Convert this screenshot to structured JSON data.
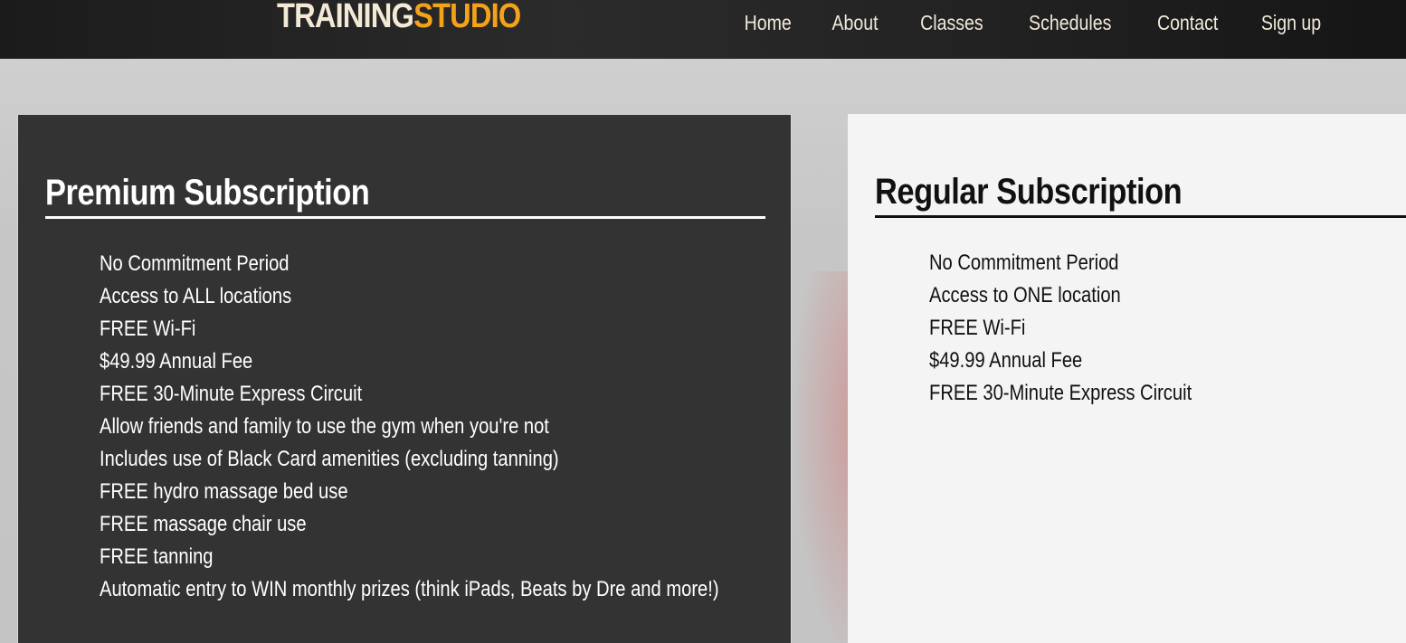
{
  "logo": {
    "part1": "TRAINING",
    "part2": "STUDIO"
  },
  "nav": [
    "Home",
    "About",
    "Classes",
    "Schedules",
    "Contact",
    "Sign up"
  ],
  "premium": {
    "title": "Premium Subscription",
    "features": [
      "No Commitment Period",
      "Access to ALL locations",
      "FREE Wi-Fi",
      "$49.99 Annual Fee",
      "FREE 30-Minute Express Circuit",
      "Allow friends and family to use the gym when you're not",
      "Includes use of Black Card amenities (excluding tanning)",
      "FREE hydro massage bed use",
      "FREE massage chair use",
      "FREE tanning",
      "Automatic entry to WIN monthly prizes (think iPads, Beats by Dre and more!)"
    ]
  },
  "regular": {
    "title": "Regular Subscription",
    "features": [
      "No Commitment Period",
      "Access to ONE location",
      "FREE Wi-Fi",
      "$49.99 Annual Fee",
      "FREE 30-Minute Express Circuit"
    ]
  },
  "colors": {
    "accent": "#f3a21a",
    "header_bg": "#222222",
    "premium_bg": "#333333",
    "regular_bg": "#f4f4f4"
  }
}
